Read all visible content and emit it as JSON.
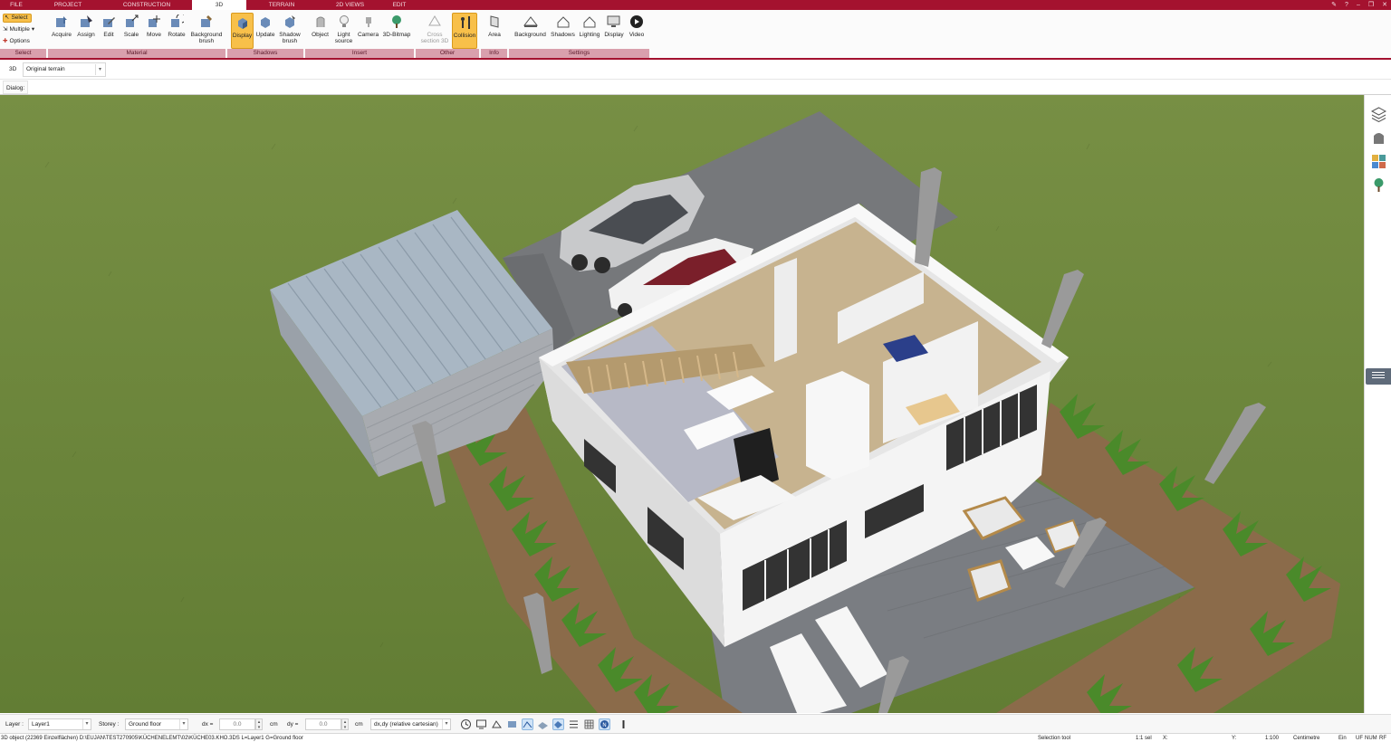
{
  "tabs": [
    {
      "label": "FILE"
    },
    {
      "label": "PROJECT"
    },
    {
      "label": "CONSTRUCTION"
    },
    {
      "label": "3D"
    },
    {
      "label": "TERRAIN"
    },
    {
      "label": "2D VIEWS"
    },
    {
      "label": "EDIT"
    }
  ],
  "active_tab": "3D",
  "window_icons": [
    "pin-icon",
    "help-icon",
    "minimize-icon",
    "restore-icon",
    "close-icon"
  ],
  "ribbon": {
    "select_group": {
      "select_label": "Select",
      "multiple_label": "Multiple",
      "options_label": "Options",
      "group_label": "Select"
    },
    "material": {
      "buttons": [
        {
          "label": "Acquire",
          "icon": "acquire-icon"
        },
        {
          "label": "Assign",
          "icon": "assign-icon"
        },
        {
          "label": "Edit",
          "icon": "edit-icon"
        },
        {
          "label": "Scale",
          "icon": "scale-icon"
        },
        {
          "label": "Move",
          "icon": "move-icon"
        },
        {
          "label": "Rotate",
          "icon": "rotate-icon"
        },
        {
          "label": "Background",
          "label2": "brush",
          "icon": "background-brush-icon"
        }
      ],
      "group_label": "Material"
    },
    "shadows": {
      "buttons": [
        {
          "label": "Display",
          "icon": "display-shadows-icon",
          "active": true
        },
        {
          "label": "Update",
          "icon": "update-icon"
        },
        {
          "label": "Shadow",
          "label2": "brush",
          "icon": "shadow-brush-icon"
        }
      ],
      "group_label": "Shadows"
    },
    "insert": {
      "buttons": [
        {
          "label": "Object",
          "icon": "object-icon"
        },
        {
          "label": "Light",
          "label2": "source",
          "icon": "light-source-icon"
        },
        {
          "label": "Camera",
          "icon": "camera-icon"
        },
        {
          "label": "3D-Bitmap",
          "icon": "tree-bitmap-icon"
        }
      ],
      "group_label": "Insert"
    },
    "other": {
      "buttons": [
        {
          "label": "Cross",
          "label2": "section 3D",
          "icon": "cross-section-icon",
          "disabled": true
        },
        {
          "label": "Collision",
          "icon": "collision-icon",
          "active": true
        }
      ],
      "group_label": "Other"
    },
    "info": {
      "buttons": [
        {
          "label": "Area",
          "icon": "area-icon"
        }
      ],
      "group_label": "Info"
    },
    "settings": {
      "buttons": [
        {
          "label": "Background",
          "icon": "background-icon"
        },
        {
          "label": "Shadows",
          "icon": "shadows-icon"
        },
        {
          "label": "Lighting",
          "icon": "lighting-icon"
        },
        {
          "label": "Display",
          "icon": "display-icon"
        },
        {
          "label": "Video",
          "icon": "video-icon"
        }
      ],
      "group_label": "Settings"
    }
  },
  "viewbar": {
    "view_label": "3D",
    "terrain_value": "Original terrain"
  },
  "dialog_label": "Dialog:",
  "sidebar_icons": [
    "layers-icon",
    "furniture-icon",
    "materials-icon",
    "plants-icon"
  ],
  "inputbar": {
    "layer_label": "Layer :",
    "layer_value": "Layer1",
    "storey_label": "Storey :",
    "storey_value": "Ground floor",
    "dx_label": "dx =",
    "dx_value": "0.0",
    "dx_unit": "cm",
    "dy_label": "dy =",
    "dy_value": "0.0",
    "dy_unit": "cm",
    "mode_value": "dx,dy (relative cartesian)",
    "tools": [
      "clock-icon",
      "screen-icon",
      "snap-icon",
      "layers-snap-icon",
      "angle-icon",
      "wall-snap-icon",
      "surface-icon",
      "list-icon",
      "grid-icon",
      "north-icon",
      "info-icon"
    ]
  },
  "statusbar": {
    "info": "3D object (22369 Einzelflächen) D:\\EUJAN\\TEST270905\\KÜCHENELEMT\\02\\KÜCHE03.KHO.3DS L=Layer1 G=Ground floor",
    "tool": "Selection tool",
    "selection": "1:1 sel",
    "x_label": "X:",
    "y_label": "Y:",
    "scale": "1:100",
    "unit": "Centimetre",
    "ein": "Ein",
    "uf": "UF",
    "num": "NUM",
    "rf": "RF"
  }
}
